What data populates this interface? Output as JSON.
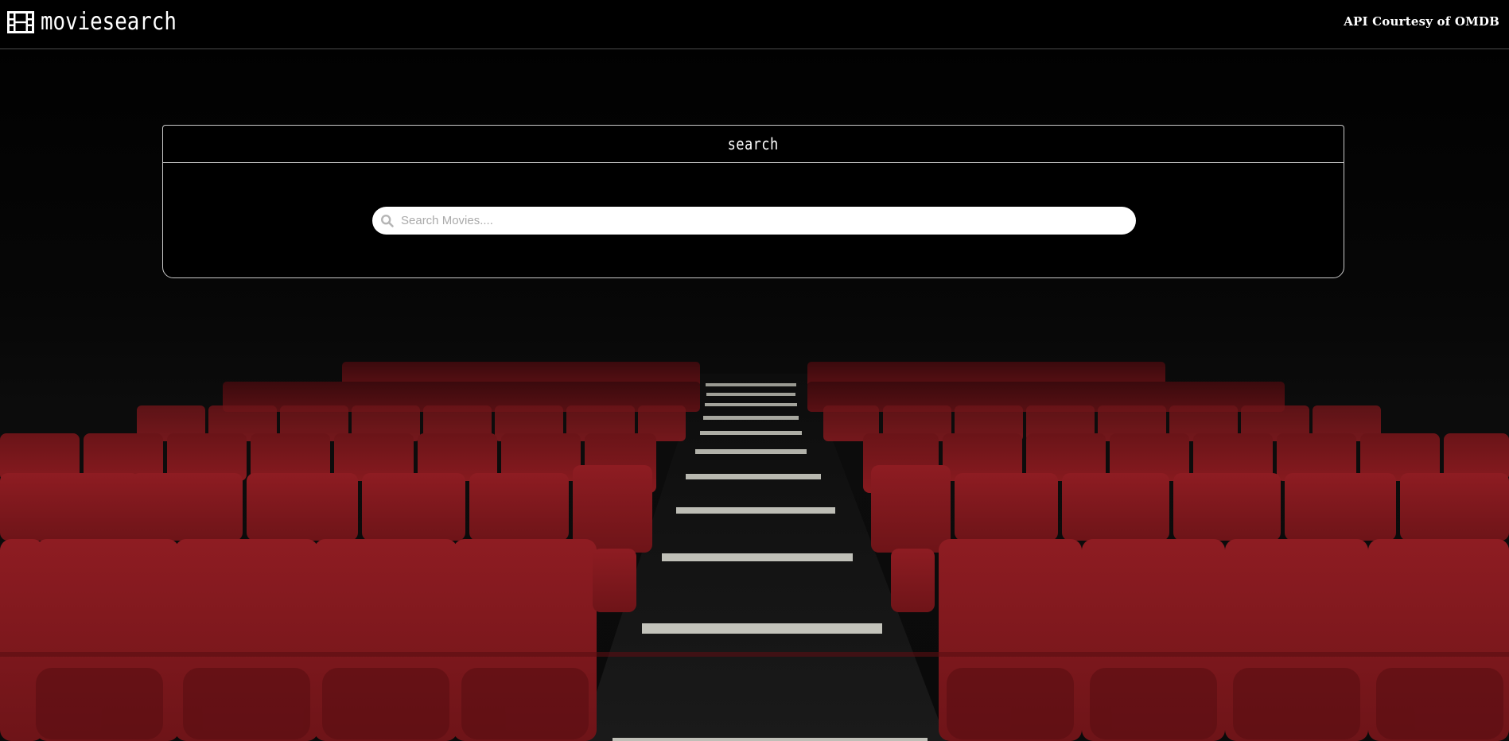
{
  "navbar": {
    "brand": "moviesearch",
    "brand_icon": "film-icon",
    "credit": "API Courtesy of OMDB"
  },
  "search_card": {
    "title": "search",
    "search": {
      "placeholder": "Search Movies....",
      "value": "",
      "icon": "search-icon"
    }
  },
  "background": {
    "image": "theater-seats-background",
    "seat_color": "#8b1a1f",
    "base_color": "#000000"
  }
}
